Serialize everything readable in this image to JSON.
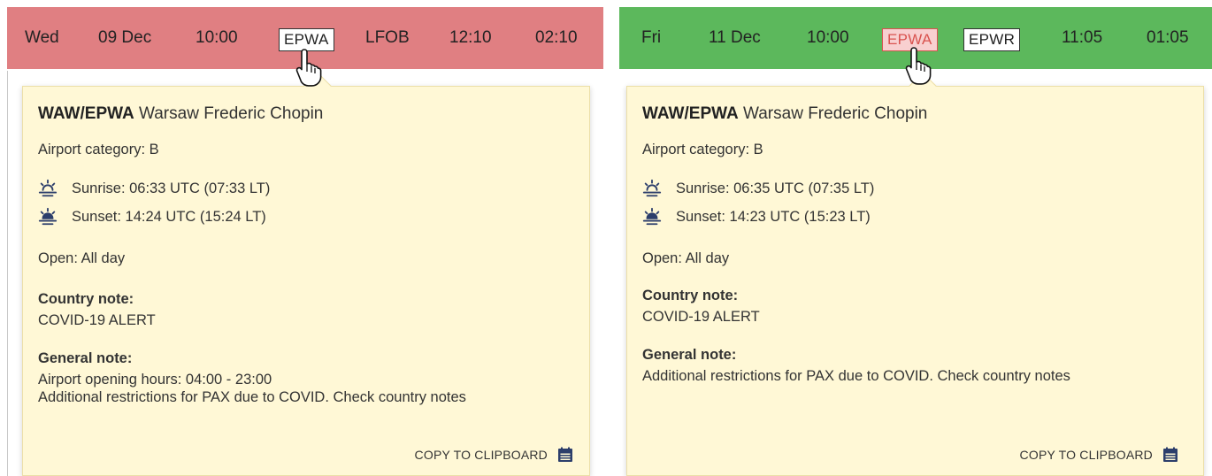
{
  "left": {
    "bar": {
      "day": "Wed",
      "date": "09 Dec",
      "dep_time": "10:00",
      "from": "EPWA",
      "to": "LFOB",
      "arr_time": "12:10",
      "duration": "02:10",
      "color": "#e07f82"
    },
    "card": {
      "code": "WAW/EPWA",
      "name": " Warsaw Frederic Chopin",
      "category": "Airport category: B",
      "sunrise": "Sunrise: 06:33 UTC (07:33 LT)",
      "sunset": "Sunset: 14:24 UTC (15:24 LT)",
      "open": "Open: All day",
      "country_note_label": "Country note:",
      "country_note": "COVID-19 ALERT",
      "general_note_label": "General note:",
      "general_note_line1": "Airport opening hours: 04:00 - 23:00",
      "general_note_line2": "Additional restrictions for PAX due to COVID. Check country notes",
      "copy_label": "COPY TO CLIPBOARD"
    }
  },
  "right": {
    "bar": {
      "day": "Fri",
      "date": "11 Dec",
      "dep_time": "10:00",
      "from": "EPWA",
      "to": "EPWR",
      "arr_time": "11:05",
      "duration": "01:05",
      "color": "#5cb85c"
    },
    "card": {
      "code": "WAW/EPWA",
      "name": " Warsaw Frederic Chopin",
      "category": "Airport category: B",
      "sunrise": "Sunrise: 06:35 UTC (07:35 LT)",
      "sunset": "Sunset: 14:23 UTC (15:23 LT)",
      "open": "Open: All day",
      "country_note_label": "Country note:",
      "country_note": "COVID-19 ALERT",
      "general_note_label": "General note:",
      "general_note_line1": "Additional restrictions for PAX due to COVID. Check country notes",
      "copy_label": "COPY TO CLIPBOARD"
    }
  },
  "icons": {
    "sunrise": "sunrise-icon",
    "sunset": "sunset-icon",
    "clipboard": "clipboard-icon",
    "cursor": "hand-pointer-cursor"
  },
  "colors": {
    "card_bg": "#fff8d6",
    "icon_blue": "#2c3e6b",
    "active_code_border": "#d9534f"
  }
}
